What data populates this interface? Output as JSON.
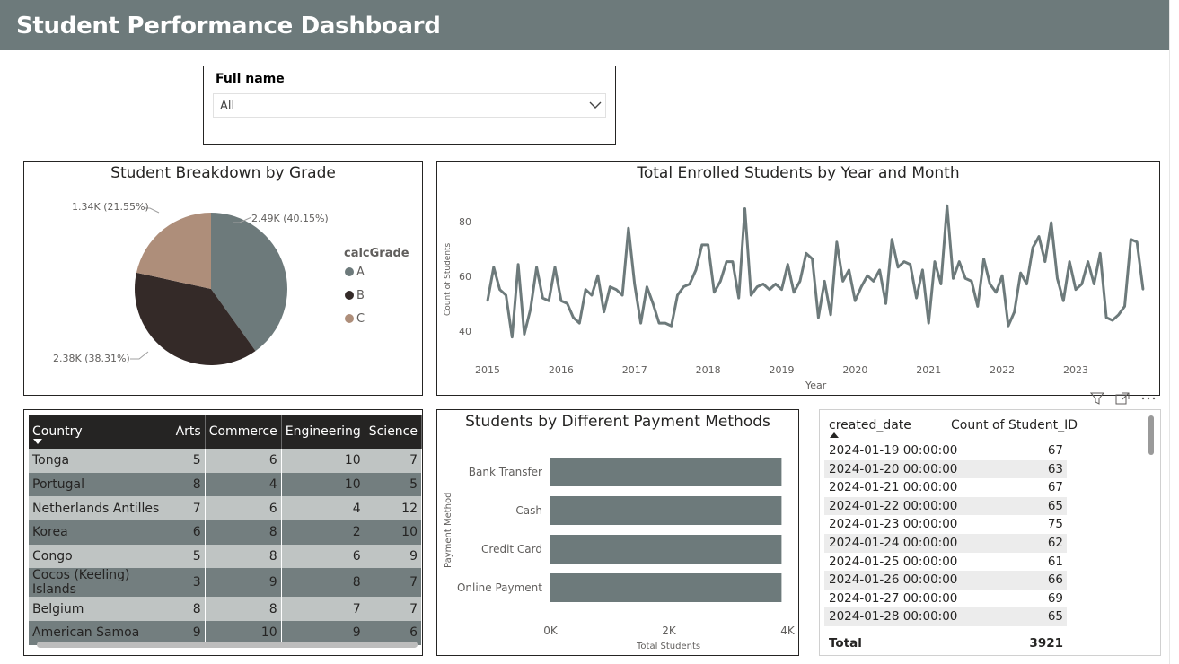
{
  "header": {
    "title": "Student Performance Dashboard"
  },
  "slicer": {
    "label": "Full name",
    "value": "All"
  },
  "pie": {
    "title": "Student Breakdown by Grade",
    "legend_title": "calcGrade",
    "legend": [
      "A",
      "B",
      "C"
    ],
    "labels": [
      "2.49K (40.15%)",
      "2.38K (38.31%)",
      "1.34K (21.55%)"
    ],
    "colors": [
      "#6d7a7b",
      "#342a28",
      "#ae8e7a"
    ]
  },
  "line": {
    "title": "Total Enrolled Students by Year and Month",
    "ylabel": "Count of Students",
    "xlabel": "Year",
    "yticks": [
      "80",
      "60",
      "40"
    ],
    "xticks": [
      "2015",
      "2016",
      "2017",
      "2018",
      "2019",
      "2020",
      "2021",
      "2022",
      "2023"
    ]
  },
  "matrix": {
    "headers": [
      "Country",
      "Arts",
      "Commerce",
      "Engineering",
      "Science"
    ],
    "rows": [
      [
        "Tonga",
        "5",
        "6",
        "10",
        "7"
      ],
      [
        "Portugal",
        "8",
        "4",
        "10",
        "5"
      ],
      [
        "Netherlands Antilles",
        "7",
        "6",
        "4",
        "12"
      ],
      [
        "Korea",
        "6",
        "8",
        "2",
        "10"
      ],
      [
        "Congo",
        "5",
        "8",
        "6",
        "9"
      ],
      [
        "Cocos (Keeling) Islands",
        "3",
        "9",
        "8",
        "7"
      ],
      [
        "Belgium",
        "8",
        "8",
        "7",
        "7"
      ],
      [
        "American Samoa",
        "9",
        "10",
        "9",
        "6"
      ]
    ]
  },
  "bar": {
    "title": "Students by Different Payment Methods",
    "ylabel": "Payment Method",
    "xlabel": "Total Students",
    "xticks": [
      "0K",
      "2K",
      "4K"
    ]
  },
  "table": {
    "headers": [
      "created_date",
      "Count of Student_ID"
    ],
    "rows": [
      [
        "2024-01-19 00:00:00",
        "67"
      ],
      [
        "2024-01-20 00:00:00",
        "63"
      ],
      [
        "2024-01-21 00:00:00",
        "67"
      ],
      [
        "2024-01-22 00:00:00",
        "65"
      ],
      [
        "2024-01-23 00:00:00",
        "75"
      ],
      [
        "2024-01-24 00:00:00",
        "62"
      ],
      [
        "2024-01-25 00:00:00",
        "61"
      ],
      [
        "2024-01-26 00:00:00",
        "66"
      ],
      [
        "2024-01-27 00:00:00",
        "69"
      ],
      [
        "2024-01-28 00:00:00",
        "65"
      ]
    ],
    "total_label": "Total",
    "total_value": "3921"
  },
  "icons": [
    "chevron-down-icon",
    "filter-icon",
    "focus-mode-icon",
    "more-options-icon",
    "sort-ascending-icon"
  ],
  "chart_data": [
    {
      "type": "pie",
      "title": "Student Breakdown by Grade",
      "categories": [
        "A",
        "B",
        "C"
      ],
      "values": [
        2490,
        2380,
        1340
      ],
      "percentages": [
        40.15,
        38.31,
        21.55
      ],
      "legend": "right"
    },
    {
      "type": "line",
      "title": "Total Enrolled Students by Year and Month",
      "xlabel": "Year",
      "ylabel": "Count of Students",
      "ylim": [
        35,
        88
      ],
      "x_start": "2015-01",
      "x_end": "2023-12",
      "values": [
        51,
        63,
        55,
        53,
        38,
        64,
        39,
        48,
        63,
        52,
        51,
        63,
        51,
        50,
        45,
        43,
        55,
        53,
        60,
        47,
        56,
        55,
        53,
        77,
        57,
        43,
        56,
        50,
        43,
        43,
        42,
        53,
        56,
        57,
        62,
        71,
        71,
        54,
        58,
        65,
        65,
        52,
        84,
        53,
        56,
        57,
        55,
        57,
        55,
        64,
        54,
        58,
        68,
        66,
        45,
        58,
        46,
        72,
        58,
        62,
        51,
        56,
        60,
        58,
        62,
        50,
        73,
        63,
        65,
        64,
        52,
        62,
        43,
        65,
        57,
        85,
        59,
        65,
        59,
        58,
        49,
        66,
        57,
        54,
        60,
        42,
        47,
        61,
        57,
        70,
        74,
        65,
        79,
        59,
        51,
        65,
        55,
        57,
        65,
        57,
        68,
        45,
        44,
        46,
        49,
        73,
        72,
        55
      ],
      "grid": false
    },
    {
      "type": "bar",
      "orientation": "horizontal",
      "title": "Students by Different Payment Methods",
      "categories": [
        "Bank Transfer",
        "Cash",
        "Credit Card",
        "Online Payment"
      ],
      "values": [
        3900,
        3900,
        3900,
        3900
      ],
      "xlabel": "Total Students",
      "ylabel": "Payment Method",
      "xlim": [
        0,
        4000
      ]
    }
  ]
}
